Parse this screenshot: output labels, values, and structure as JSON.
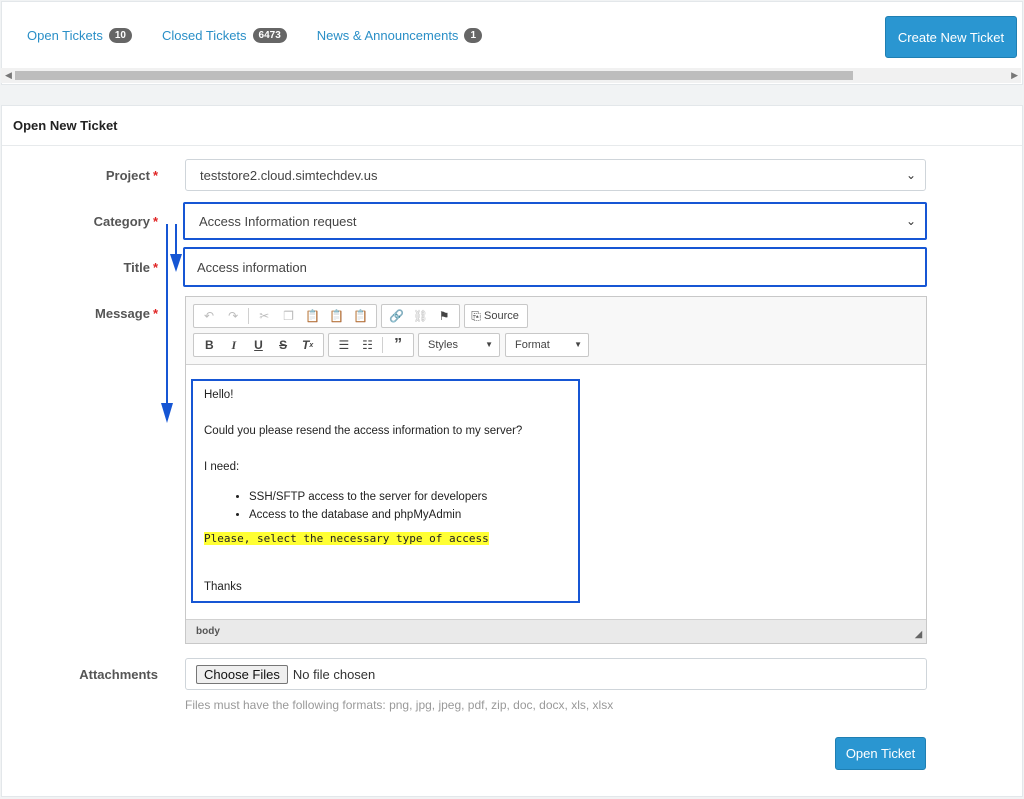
{
  "tabs": [
    {
      "label": "Open Tickets",
      "count": "10"
    },
    {
      "label": "Closed Tickets",
      "count": "6473"
    },
    {
      "label": "News & Announcements",
      "count": "1"
    }
  ],
  "create_button": "Create New Ticket",
  "form": {
    "heading": "Open New Ticket",
    "project_label": "Project",
    "project_value": "teststore2.cloud.simtechdev.us",
    "category_label": "Category",
    "category_value": "Access Information request",
    "title_label": "Title",
    "title_value": "Access information",
    "message_label": "Message",
    "attachments_label": "Attachments",
    "required_mark": "*"
  },
  "editor": {
    "source_label": "Source",
    "styles_label": "Styles",
    "format_label": "Format",
    "status_path": "body",
    "content": {
      "greeting": "Hello!",
      "question": "Could you please resend the access information to my server?",
      "need": "I need:",
      "items": [
        "SSH/SFTP access to the server for developers",
        "Access to the database and phpMyAdmin"
      ],
      "highlight": "Please, select the necessary type of access",
      "closing": "Thanks"
    }
  },
  "attachments": {
    "button": "Choose Files",
    "status": "No file chosen",
    "help": "Files must have the following formats: png, jpg, jpeg, pdf, zip, doc, docx, xls, xlsx"
  },
  "submit_button": "Open Ticket",
  "colors": {
    "accent": "#2a96d1",
    "annotation": "#1656d4",
    "highlight": "#ffff33",
    "required": "#e02424"
  }
}
